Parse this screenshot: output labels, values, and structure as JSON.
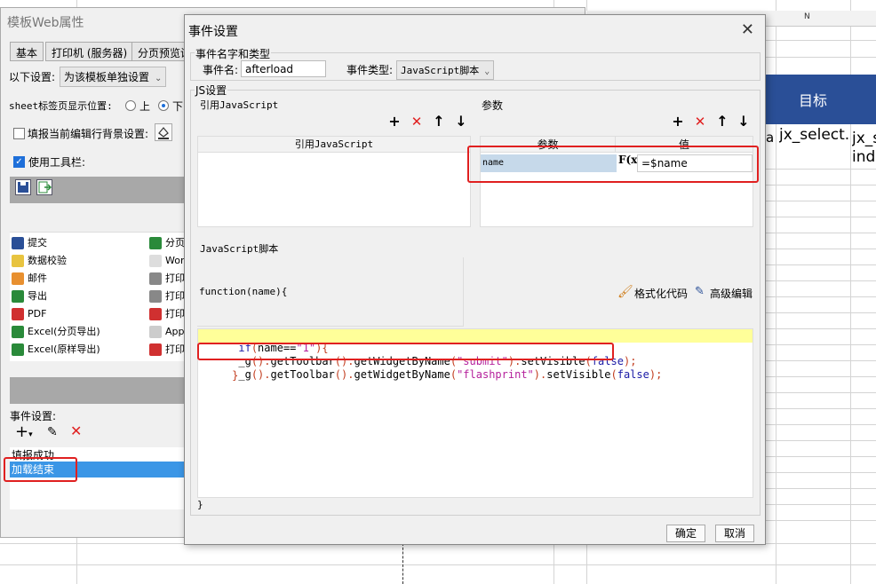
{
  "sheet": {
    "col_header": "N",
    "header_cell": "目标",
    "cell_a": "a",
    "cell_b": "jx_select.G(index_",
    "cell_c": "jx_s ind"
  },
  "left_window": {
    "title": "模板Web属性",
    "tabs": [
      "基本",
      "打印机 (服务器)",
      "分页预览设"
    ],
    "setting_label": "以下设置:",
    "setting_value": "为该模板单独设置",
    "sheet_tab_label": "sheet标签页显示位置:",
    "radio_top": "上",
    "radio_bottom": "下",
    "fill_bg_label": "填报当前编辑行背景设置:",
    "use_toolbar_label": "使用工具栏:",
    "buttons_col1": [
      "提交",
      "数据校验",
      "邮件",
      "导出",
      "PDF",
      "Excel(分页导出)",
      "Excel(原样导出)"
    ],
    "buttons_col2": [
      "分页",
      "Wor",
      "打印",
      "打印",
      "打印",
      "App",
      "打印"
    ],
    "event_label": "事件设置:",
    "events": [
      "填报成功",
      "加载结束"
    ]
  },
  "dialog": {
    "title": "事件设置",
    "name_group": "事件名字和类型",
    "event_name_label": "事件名:",
    "event_name_value": "afterload",
    "event_type_label": "事件类型:",
    "event_type_value": "JavaScript脚本",
    "js_group": "JS设置",
    "ref_js_label": "引用JavaScript",
    "ref_js_header": "引用JavaScript",
    "params_label": "参数",
    "param_col": "参数",
    "value_col": "值",
    "param_name": "name",
    "param_formula_icon": "F(x)",
    "param_value": "=$name",
    "script_label": "JavaScript脚本",
    "function_sig": "function(name){",
    "format_code": "格式化代码",
    "advanced_edit": "高级编辑",
    "code_lines": [
      "if(name==\"1\"){",
      "_g().getToolbar().getWidgetByName(\"submit\").setVisible(false);",
      "_g().getToolbar().getWidgetByName(\"flashprint\").setVisible(false);",
      "     }"
    ],
    "closing_brace": "}",
    "ok": "确定",
    "cancel": "取消"
  },
  "colors": {
    "header_blue": "#2a4f97",
    "selection_blue": "#3b96e6",
    "highlight_red": "#e02020",
    "code_highlight": "#ffff99"
  }
}
